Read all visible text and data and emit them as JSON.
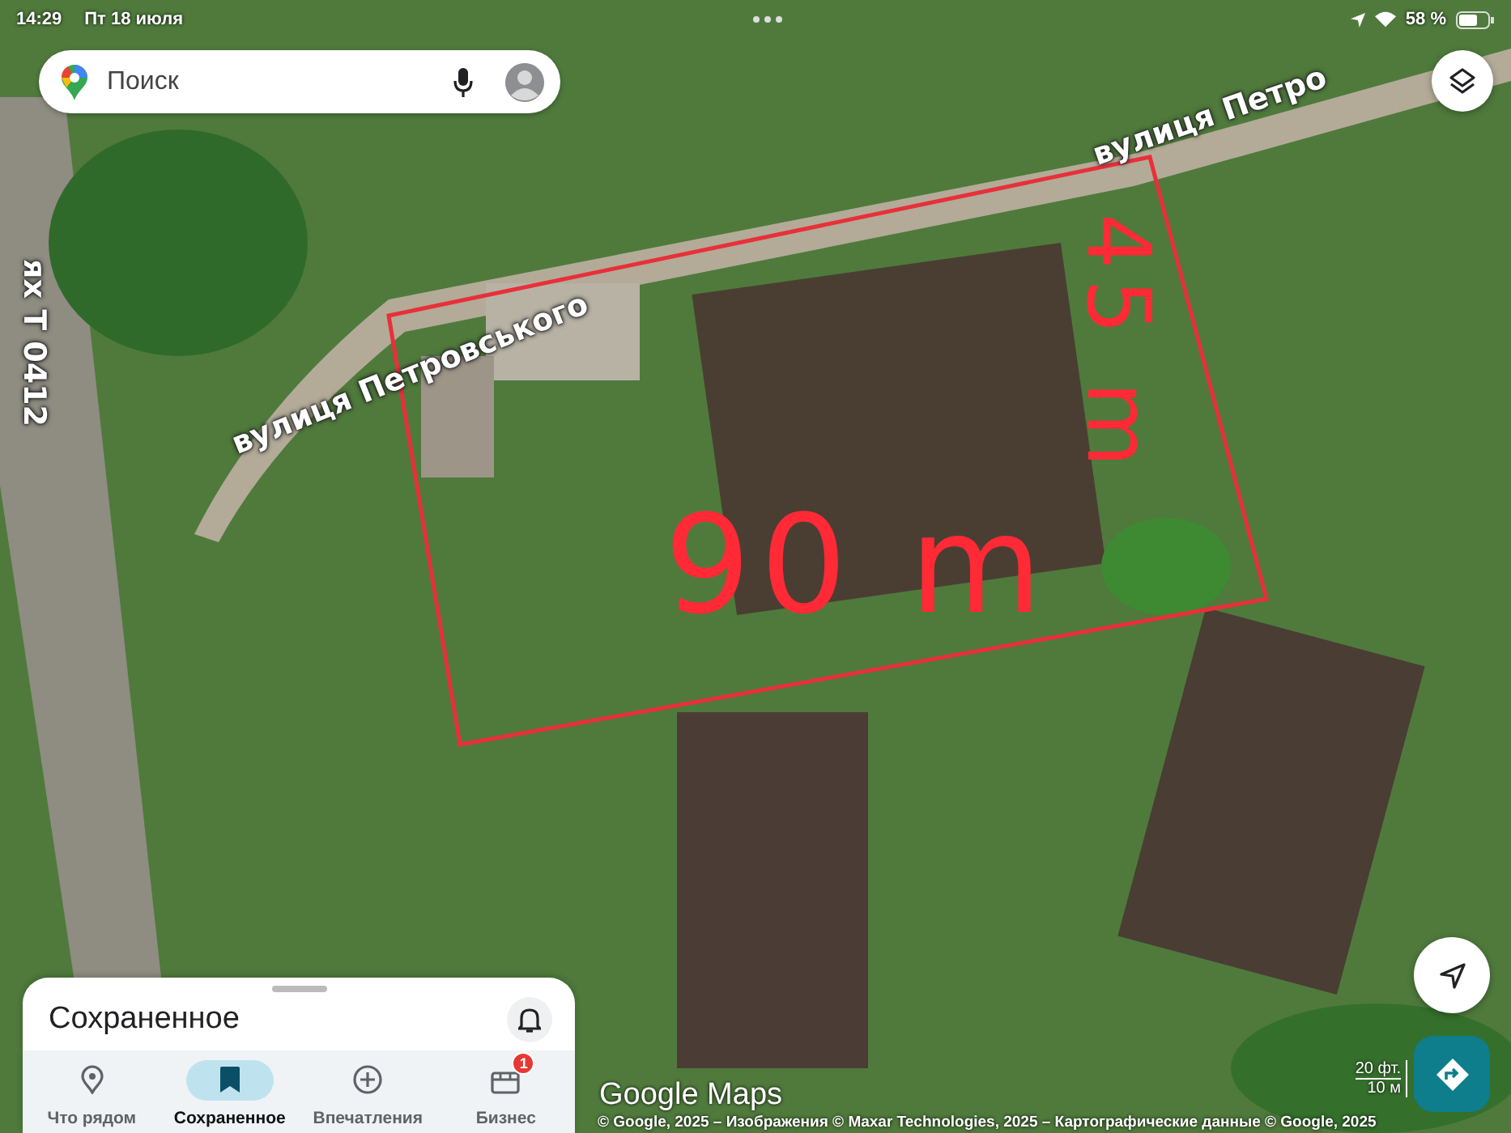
{
  "status_bar": {
    "time": "14:29",
    "date": "Пт 18 июля",
    "battery": "58 %"
  },
  "search": {
    "placeholder": "Поиск"
  },
  "map": {
    "labels": [
      {
        "text": "вулиця Петровського"
      },
      {
        "text": "вулиця Петро"
      },
      {
        "text": "ях Т 0412"
      }
    ],
    "annotations": [
      {
        "text": "90 m"
      },
      {
        "text": "45 m"
      }
    ],
    "logo": "Google Maps",
    "scale": [
      "20 фт.",
      "10 м"
    ],
    "attribution": "© Google, 2025 – Изображения © Maxar Technologies, 2025 – Картографические данные © Google, 2025"
  },
  "sheet": {
    "title": "Сохраненное"
  },
  "tabs": [
    {
      "label": "Что рядом",
      "selected": false
    },
    {
      "label": "Сохраненное",
      "selected": true
    },
    {
      "label": "Впечатления",
      "selected": false
    },
    {
      "label": "Бизнес",
      "selected": false,
      "badge": "1"
    }
  ]
}
